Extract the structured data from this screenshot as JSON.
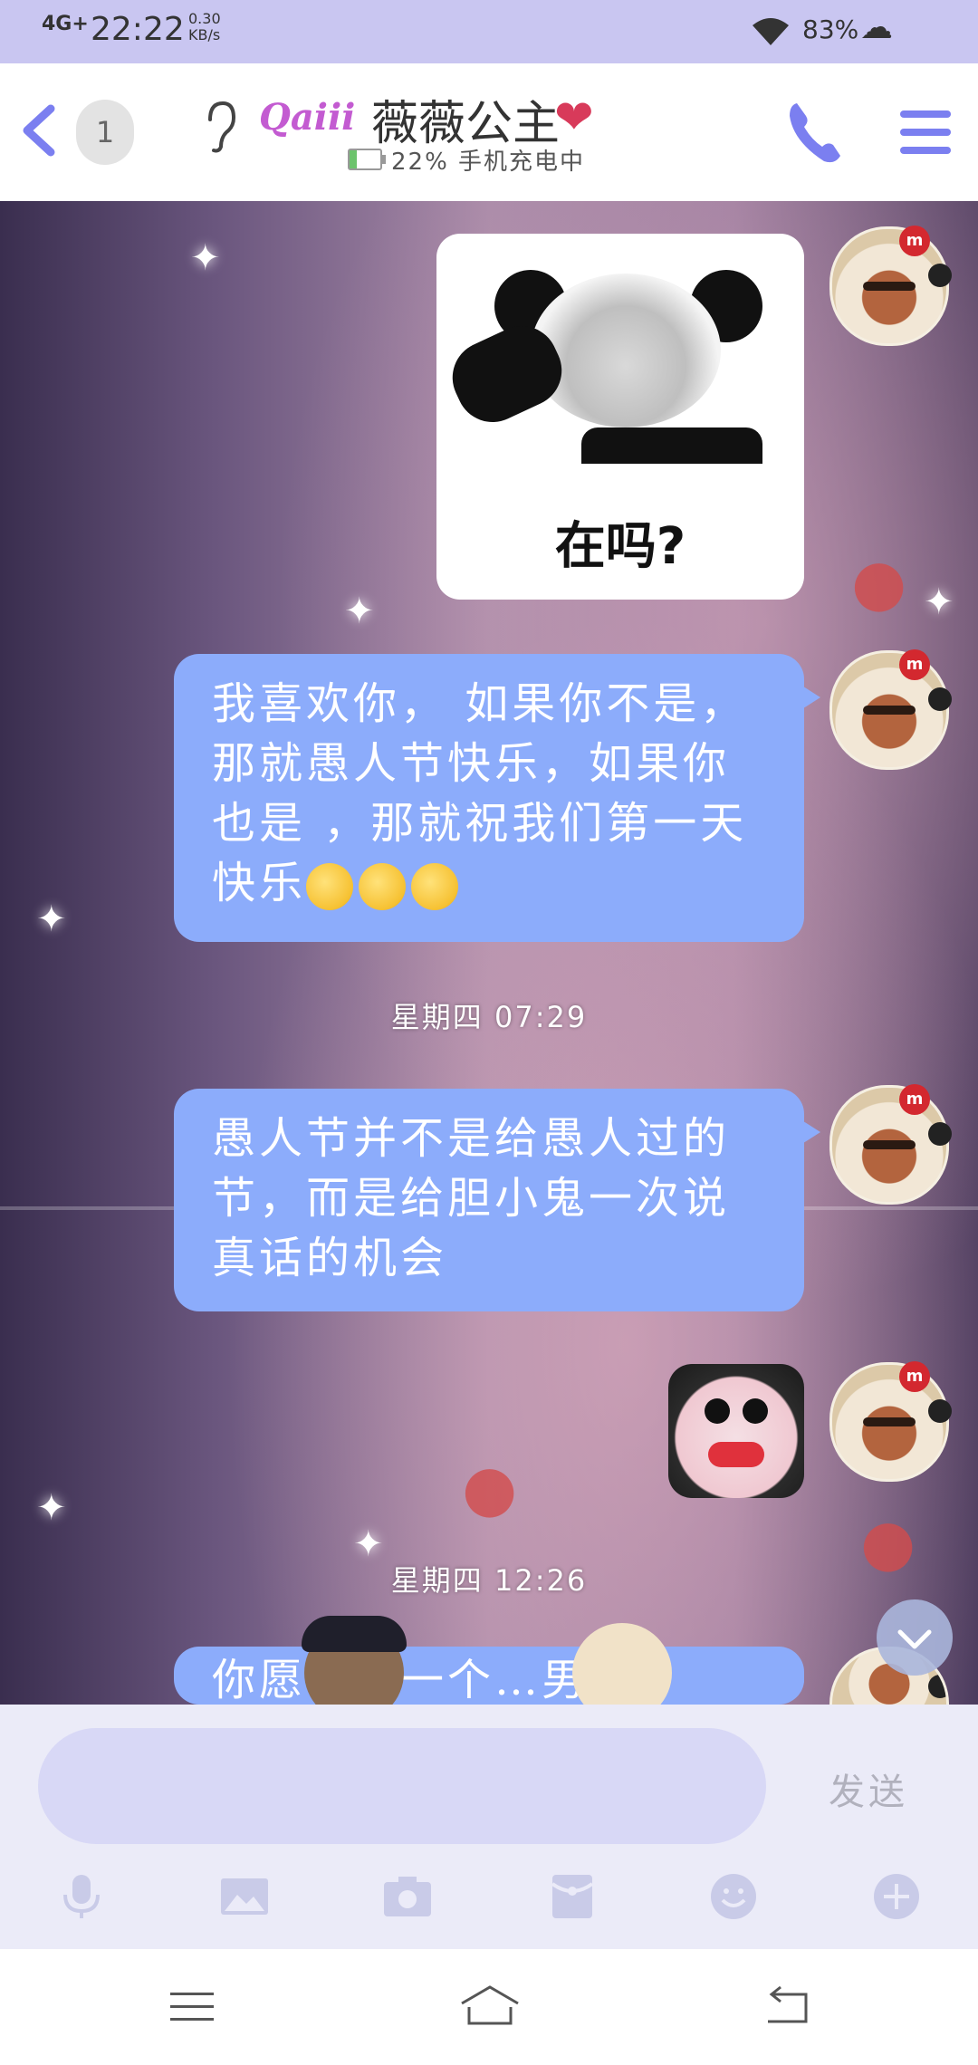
{
  "status_bar": {
    "network": "4G+",
    "time": "22:22",
    "speed_value": "0.30",
    "speed_unit": "KB/s",
    "battery": "83%"
  },
  "header": {
    "unread_count": "1",
    "name_decoration": "Qaiii",
    "contact_name": "薇薇公主",
    "status": "22% 手机充电中"
  },
  "messages": [
    {
      "type": "sticker",
      "caption": "在吗?"
    },
    {
      "type": "text",
      "text": "我喜欢你， 如果你不是，那就愚人节快乐，如果你也是 ，那就祝我们第一天快乐"
    },
    {
      "type": "timestamp",
      "text": "星期四 07:29"
    },
    {
      "type": "text",
      "text": "愚人节并不是给愚人过的节，而是给胆小鬼一次说真话的机会"
    },
    {
      "type": "sticker"
    },
    {
      "type": "timestamp",
      "text": "星期四 12:26"
    },
    {
      "type": "text",
      "text": "你愿…你一个…男孩"
    }
  ],
  "input": {
    "placeholder": "",
    "send_label": "发送"
  },
  "toolbar_icons": [
    "microphone-icon",
    "image-icon",
    "camera-icon",
    "red-packet-icon",
    "emoji-icon",
    "plus-icon"
  ],
  "colors": {
    "accent": "#7b7ff0",
    "bubble": "#8cacfb",
    "status_bar": "#c9c6f1",
    "input_bg": "#ebebf8"
  }
}
